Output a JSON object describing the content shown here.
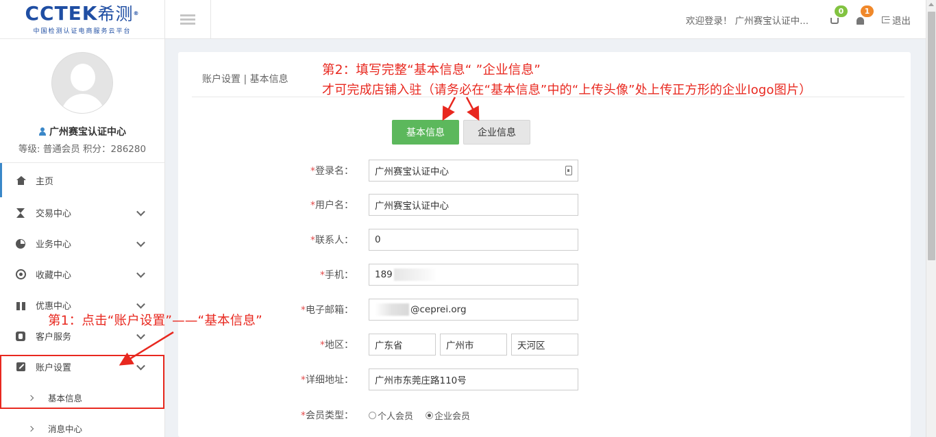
{
  "logo": {
    "brand": "CCTEK",
    "brand_cn": "希测",
    "reg": "®",
    "tagline": "中国检测认证电商服务云平台"
  },
  "profile": {
    "name": "广州赛宝认证中心",
    "meta": "等级: 普通会员  积分：286280"
  },
  "sidebar": {
    "items": [
      {
        "label": "主页",
        "icon": "home-icon"
      },
      {
        "label": "交易中心",
        "icon": "hourglass-icon"
      },
      {
        "label": "业务中心",
        "icon": "pie-chart-icon"
      },
      {
        "label": "收藏中心",
        "icon": "eye-icon"
      },
      {
        "label": "优惠中心",
        "icon": "gift-icon"
      },
      {
        "label": "客户服务",
        "icon": "phone-icon"
      },
      {
        "label": "账户设置",
        "icon": "edit-icon"
      }
    ],
    "sub_items": [
      {
        "label": "基本信息"
      },
      {
        "label": "消息中心"
      }
    ]
  },
  "topbar": {
    "welcome": "欢迎登录！ 广州赛宝认证中...",
    "cart_count": "0",
    "notice_count": "1",
    "logout": "退出"
  },
  "breadcrumb": "账户设置 | 基本信息",
  "tabs": [
    {
      "label": "基本信息",
      "active": true
    },
    {
      "label": "企业信息",
      "active": false
    }
  ],
  "form": {
    "login_name": {
      "label": "登录名：",
      "value": "广州赛宝认证中心"
    },
    "username": {
      "label": "用户名：",
      "value": "广州赛宝认证中心"
    },
    "contact": {
      "label": "联系人：",
      "value": "0"
    },
    "phone": {
      "label": "手机：",
      "value": "189"
    },
    "email": {
      "label": "电子邮箱：",
      "value": "@ceprei.org"
    },
    "region": {
      "label": "地区：",
      "province": "广东省",
      "city": "广州市",
      "district": "天河区"
    },
    "address": {
      "label": "详细地址：",
      "value": "广州市东莞庄路110号"
    },
    "member_type": {
      "label": "会员类型：",
      "options": [
        "个人会员",
        "企业会员"
      ],
      "selected": "企业会员"
    },
    "required_mark": "*"
  },
  "annotations": {
    "step2_line1": "第2：填写完整“基本信息“ ”企业信息”",
    "step2_line2": "才可完成店铺入驻（请务必在“基本信息”中的“上传头像”处上传正方形的企业logo图片）",
    "step1": "第1：点击“账户设置”——“基本信息”",
    "color": "#e8281f"
  },
  "colors": {
    "accent_green": "#5cb85c",
    "brand_blue": "#1f4ea3",
    "badge_green": "#82c341",
    "badge_orange": "#f0882a"
  }
}
